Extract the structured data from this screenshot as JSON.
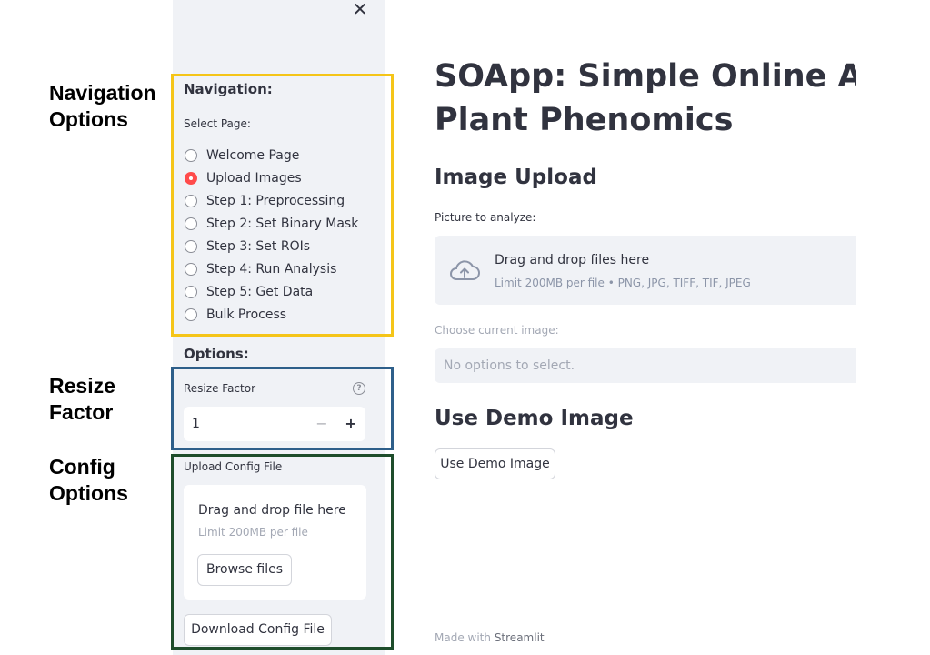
{
  "annotations": {
    "navigation": "Navigation\nOptions",
    "resize": "Resize\nFactor",
    "config": "Config\nOptions"
  },
  "colors": {
    "navigation_box": "#f5c518",
    "resize_box": "#2e5f8a",
    "config_box": "#1e4d2b",
    "accent": "#ff4b4b",
    "sidebar_bg": "#f0f2f6"
  },
  "sidebar": {
    "close_icon": "close-icon",
    "close_glyph": "✕",
    "navigation_title": "Navigation:",
    "select_page_label": "Select Page:",
    "pages": [
      {
        "label": "Welcome Page",
        "selected": false
      },
      {
        "label": "Upload Images",
        "selected": true
      },
      {
        "label": "Step 1: Preprocessing",
        "selected": false
      },
      {
        "label": "Step 2: Set Binary Mask",
        "selected": false
      },
      {
        "label": "Step 3: Set ROIs",
        "selected": false
      },
      {
        "label": "Step 4: Run Analysis",
        "selected": false
      },
      {
        "label": "Step 5: Get Data",
        "selected": false
      },
      {
        "label": "Bulk Process",
        "selected": false
      }
    ],
    "options_title": "Options:",
    "resize_label": "Resize Factor",
    "resize_value": "1",
    "help_icon": "help-icon",
    "minus": "−",
    "plus": "+",
    "config_label": "Upload Config File",
    "config_drop_text": "Drag and drop file here",
    "config_limit": "Limit 200MB per file",
    "browse_button": "Browse files",
    "download_button": "Download Config File"
  },
  "main": {
    "title": "SOApp: Simple Online Automated Plant Phenomics",
    "title_line1": "SOApp: Simple Online Auto",
    "title_line2": "Plant Phenomics",
    "image_upload_heading": "Image Upload",
    "picture_label": "Picture to analyze:",
    "upload_icon": "cloud-upload-icon",
    "drop_text": "Drag and drop files here",
    "drop_limit": "Limit 200MB per file • PNG, JPG, TIFF, TIF, JPEG",
    "choose_label": "Choose current image:",
    "choose_placeholder": "No options to select.",
    "demo_heading": "Use Demo Image",
    "demo_button": "Use Demo Image",
    "footer_prefix": "Made with",
    "footer_brand": "Streamlit"
  }
}
